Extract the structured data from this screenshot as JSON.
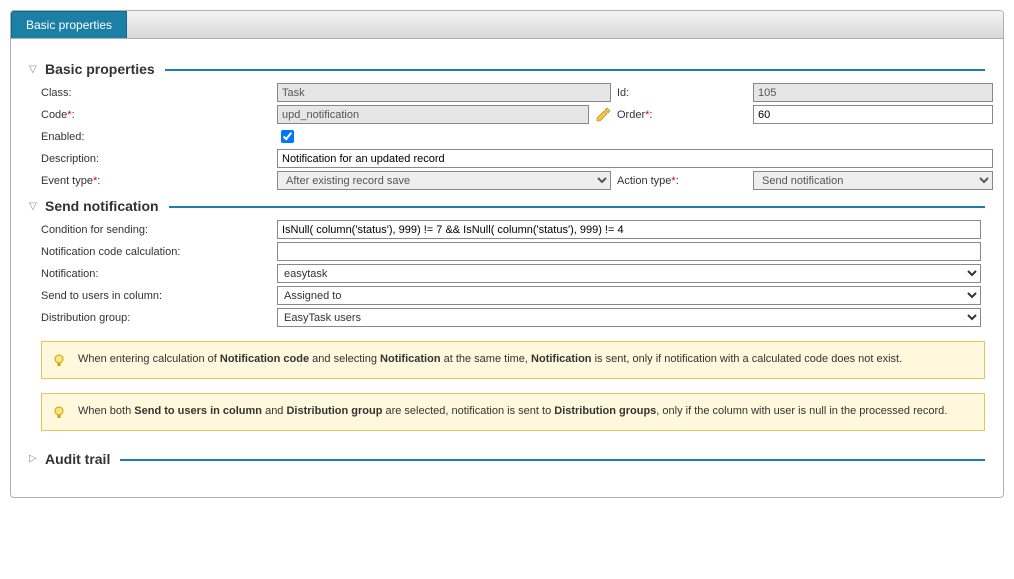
{
  "tabs": {
    "basic_properties": "Basic properties"
  },
  "sections": {
    "basic": {
      "title": "Basic properties",
      "labels": {
        "class": "Class:",
        "id": "Id:",
        "code": "Code",
        "code_suffix": ":",
        "order": "Order",
        "order_suffix": ":",
        "enabled": "Enabled:",
        "description": "Description:",
        "event_type": "Event type",
        "event_type_suffix": ":",
        "action_type": "Action type",
        "action_type_suffix": ":"
      },
      "values": {
        "class": "Task",
        "id": "105",
        "code": "upd_notification",
        "order": "60",
        "enabled": true,
        "description": "Notification for an updated record",
        "event_type": "After existing record save",
        "action_type": "Send notification"
      }
    },
    "send": {
      "title": "Send notification",
      "labels": {
        "condition": "Condition for sending:",
        "calc": "Notification code calculation:",
        "notification": "Notification:",
        "send_col": "Send to users in column:",
        "dist_group": "Distribution group:"
      },
      "values": {
        "condition": "IsNull( column('status'), 999) != 7 && IsNull( column('status'), 999) != 4",
        "calc": "",
        "notification": "easytask",
        "send_col": "Assigned to",
        "dist_group": "EasyTask users"
      }
    },
    "audit": {
      "title": "Audit trail"
    }
  },
  "info": {
    "msg1_pre": "When entering calculation of ",
    "msg1_b1": "Notification code",
    "msg1_mid1": " and selecting ",
    "msg1_b2": "Notification",
    "msg1_mid2": " at the same time, ",
    "msg1_b3": "Notification",
    "msg1_end": " is sent, only if notification with a calculated code does not exist.",
    "msg2_pre": "When both ",
    "msg2_b1": "Send to users in column",
    "msg2_mid1": " and ",
    "msg2_b2": "Distribution group",
    "msg2_mid2": " are selected, notification is sent to ",
    "msg2_b3": "Distribution groups",
    "msg2_end": ", only if the column with user is null in the processed record."
  },
  "req": "*"
}
